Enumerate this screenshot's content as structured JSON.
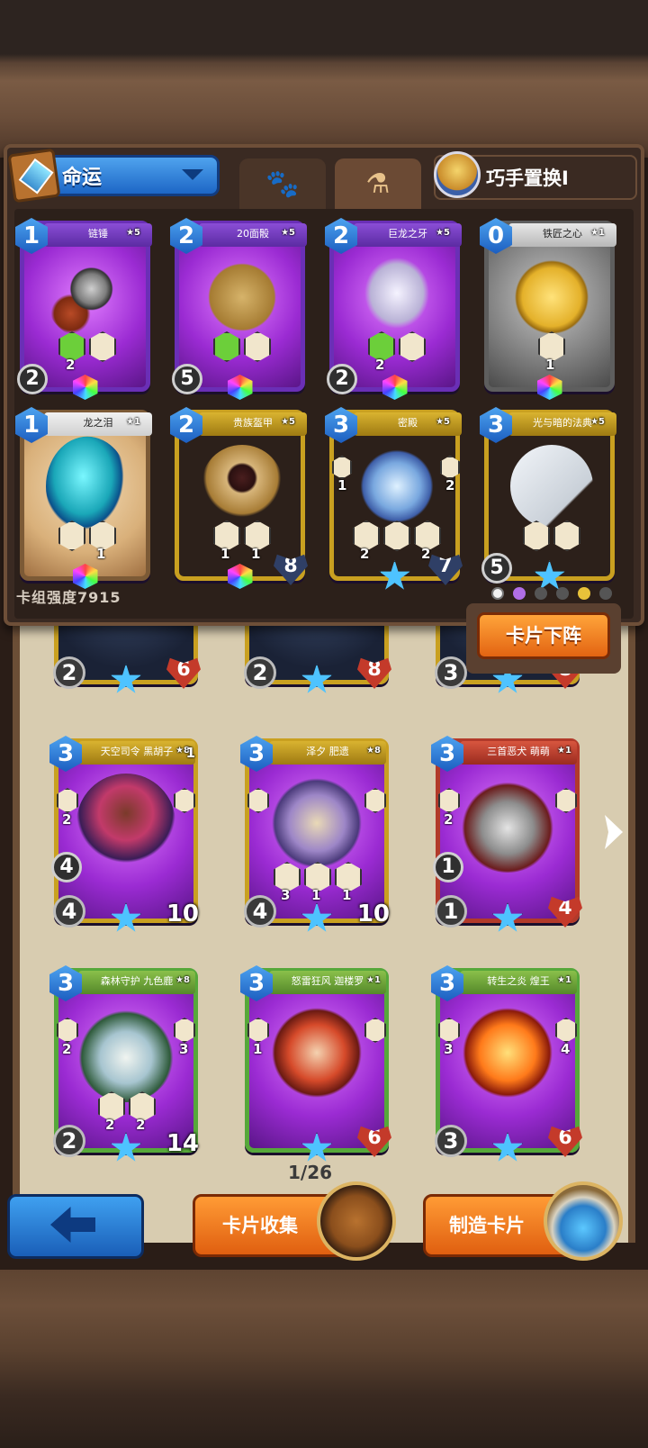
{
  "header": {
    "deck_selector_label": "命运",
    "swap_label": "巧手置换Ⅰ",
    "tabs": [
      {
        "name": "paw-tab",
        "glyph": "🐾"
      },
      {
        "name": "potion-tab",
        "glyph": "⚗"
      }
    ]
  },
  "deck_cards": [
    {
      "name": "链锤",
      "stars": "★5",
      "cost": "1",
      "dice": "2",
      "stats": [
        "2",
        ""
      ],
      "theme": "purple",
      "art": "mace"
    },
    {
      "name": "20面骰",
      "stars": "★5",
      "cost": "2",
      "dice": "5",
      "stats": [
        "",
        ""
      ],
      "theme": "purple",
      "art": "dice"
    },
    {
      "name": "巨龙之牙",
      "stars": "★5",
      "cost": "2",
      "dice": "2",
      "stats": [
        "2",
        ""
      ],
      "theme": "purple",
      "art": "fang"
    },
    {
      "name": "铁匠之心",
      "stars": "★1",
      "cost": "0",
      "dice": "",
      "stats": [
        "1"
      ],
      "theme": "grey",
      "art": "coin"
    },
    {
      "name": "龙之泪",
      "stars": "★1",
      "cost": "1",
      "dice": "",
      "stats": [
        "",
        "1"
      ],
      "theme": "tan",
      "art": "egg"
    },
    {
      "name": "贵族盔甲",
      "stars": "★5",
      "cost": "2",
      "dice": "",
      "stats": [
        "1",
        "1"
      ],
      "hp": "8",
      "theme": "gold",
      "art": "armor"
    },
    {
      "name": "密殿",
      "stars": "★5",
      "cost": "3",
      "dice": "",
      "stats": [
        "2",
        "",
        "2"
      ],
      "side": [
        "1",
        "2"
      ],
      "hp": "7",
      "theme": "gold",
      "art": "orb"
    },
    {
      "name": "光与暗的法典",
      "stars": "★5",
      "cost": "3",
      "dice": "5",
      "stats": [
        "",
        ""
      ],
      "theme": "gold",
      "art": "tome"
    }
  ],
  "deck_power_label": "卡组强度7915",
  "remove_button_label": "卡片下阵",
  "collection_row_partial": [
    {
      "atk": "2",
      "hp": "6"
    },
    {
      "atk": "2",
      "hp": "8"
    },
    {
      "atk": "3",
      "hp": "8"
    }
  ],
  "collection_cards": [
    {
      "name": "天空司令 黑胡子",
      "stars": "★8",
      "corner": "1",
      "cost": "3",
      "side": [
        "2",
        ""
      ],
      "dice": "4",
      "atk": "4",
      "hp": "10",
      "theme": "gold",
      "art": "mage"
    },
    {
      "name": "泽夕 肥遗",
      "stars": "★8",
      "corner": "",
      "cost": "3",
      "side": [
        "",
        ""
      ],
      "dice": "",
      "stats": [
        "3",
        "1",
        "1"
      ],
      "atk": "4",
      "hp": "10",
      "theme": "gold",
      "art": "hydra"
    },
    {
      "name": "三首恶犬 萌萌",
      "stars": "★1",
      "corner": "",
      "cost": "3",
      "side": [
        "2",
        ""
      ],
      "dice": "1",
      "atk": "1",
      "hp": "4",
      "theme": "red",
      "art": "wolves"
    },
    {
      "name": "森林守护 九色鹿",
      "stars": "★8",
      "corner": "",
      "cost": "3",
      "side": [
        "2",
        "3"
      ],
      "dice": "",
      "stats": [
        "2",
        "2"
      ],
      "atk": "2",
      "hp": "14",
      "theme": "green",
      "art": "deer"
    },
    {
      "name": "怒雷狂风 迦楼罗",
      "stars": "★1",
      "corner": "",
      "cost": "3",
      "side": [
        "1",
        ""
      ],
      "dice": "",
      "stats": [],
      "atk": "",
      "hp": "6",
      "theme": "green",
      "art": "dragon"
    },
    {
      "name": "转生之炎 煌王",
      "stars": "★1",
      "corner": "",
      "cost": "3",
      "side": [
        "3",
        "4"
      ],
      "dice": "",
      "stats": [],
      "atk": "3",
      "hp": "6",
      "theme": "green",
      "art": "phoenix"
    }
  ],
  "page_indicator": "1/26",
  "footer": {
    "back_label": "",
    "collection_label": "卡片收集",
    "craft_label": "制造卡片"
  }
}
